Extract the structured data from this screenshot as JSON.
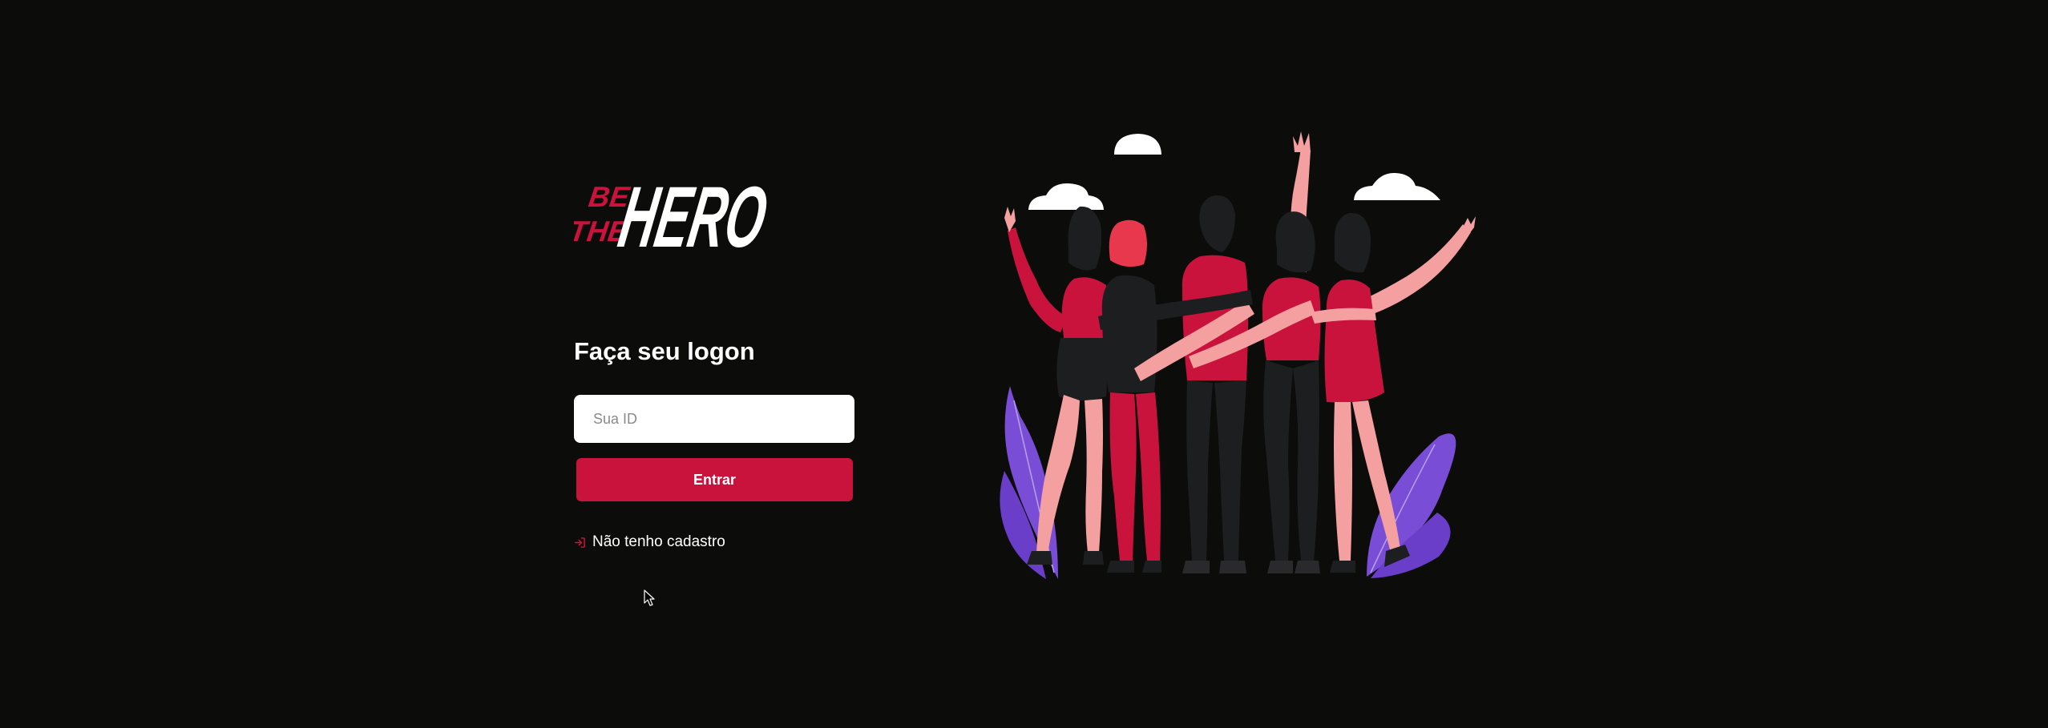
{
  "logo": {
    "text_be": "BE",
    "text_the": "THE",
    "text_hero": "HERO"
  },
  "logon": {
    "title": "Faça seu logon",
    "id_placeholder": "Sua ID",
    "id_value": "",
    "submit_label": "Entrar",
    "register_label": "Não tenho cadastro"
  },
  "icons": {
    "register": "log-in-icon",
    "cursor": "mouse-pointer-icon"
  },
  "colors": {
    "accent": "#c9133d",
    "background": "#0c0c0b",
    "text": "#ffffff"
  }
}
